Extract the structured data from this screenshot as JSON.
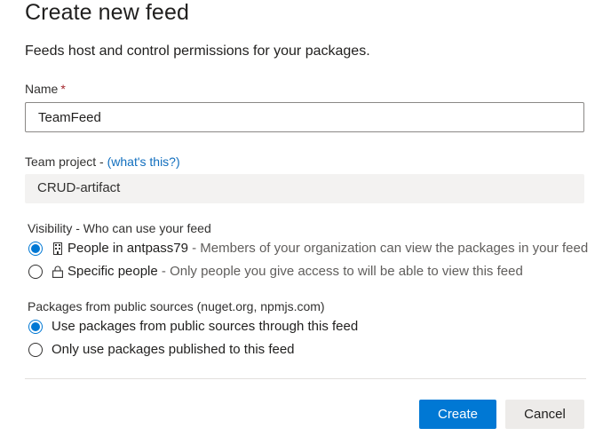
{
  "dialog": {
    "title": "Create new feed",
    "subtitle": "Feeds host and control permissions for your packages."
  },
  "name_field": {
    "label": "Name",
    "required_marker": "*",
    "value": "TeamFeed"
  },
  "team_project": {
    "label": "Team project - ",
    "help_link": "(what's this?)",
    "value": "CRUD-artifact"
  },
  "visibility": {
    "label": "Visibility - Who can use your feed",
    "options": [
      {
        "title": "People in antpass79",
        "separator": " - ",
        "description": "Members of your organization can view the packages in your feed",
        "icon": "building-icon",
        "selected": true
      },
      {
        "title": "Specific people",
        "separator": " - ",
        "description": "Only people you give access to will be able to view this feed",
        "icon": "lock-icon",
        "selected": false
      }
    ]
  },
  "public_sources": {
    "label": "Packages from public sources (nuget.org, npmjs.com)",
    "options": [
      {
        "label": "Use packages from public sources through this feed",
        "selected": true
      },
      {
        "label": "Only use packages published to this feed",
        "selected": false
      }
    ]
  },
  "actions": {
    "create_label": "Create",
    "cancel_label": "Cancel"
  },
  "colors": {
    "accent": "#0078d4",
    "link": "#106ebe",
    "required": "#a4262c"
  }
}
